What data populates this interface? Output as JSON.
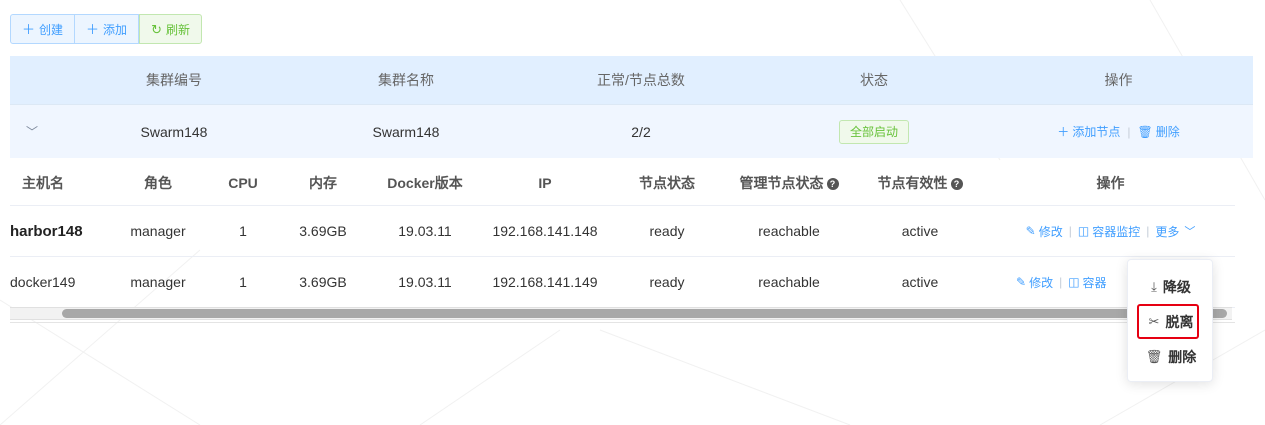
{
  "toolbar": {
    "create_label": "创建",
    "add_label": "添加",
    "refresh_label": "刷新"
  },
  "cluster_table": {
    "headers": [
      "集群编号",
      "集群名称",
      "正常/节点总数",
      "状态",
      "操作"
    ],
    "row": {
      "id": "Swarm148",
      "name": "Swarm148",
      "count": "2/2",
      "status": "全部启动",
      "add_node_label": "添加节点",
      "delete_label": "删除"
    }
  },
  "node_table": {
    "headers": {
      "host": "主机名",
      "role": "角色",
      "cpu": "CPU",
      "memory": "内存",
      "docker": "Docker版本",
      "ip": "IP",
      "node_state": "节点状态",
      "manager_state": "管理节点状态",
      "validity": "节点有效性",
      "ops": "操作"
    },
    "rows": [
      {
        "host": "harbor148",
        "role": "manager",
        "cpu": "1",
        "memory": "3.69GB",
        "docker": "19.03.11",
        "ip": "192.168.141.148",
        "node_state": "ready",
        "manager_state": "reachable",
        "validity": "active",
        "edit_label": "修改",
        "monitor_label": "容器监控",
        "more_label": "更多"
      },
      {
        "host": "docker149",
        "role": "manager",
        "cpu": "1",
        "memory": "3.69GB",
        "docker": "19.03.11",
        "ip": "192.168.141.149",
        "node_state": "ready",
        "manager_state": "reachable",
        "validity": "active",
        "edit_label": "修改",
        "monitor_label": "容器"
      }
    ]
  },
  "more_menu": {
    "items": [
      {
        "label": "降级",
        "icon": "download-icon"
      },
      {
        "label": "脱离",
        "icon": "scissors-icon"
      },
      {
        "label": "删除",
        "icon": "trash-icon"
      }
    ]
  },
  "colors": {
    "primary": "#409eff",
    "success": "#67c23a",
    "header_bg": "#e1efff",
    "highlight": "#e60012"
  }
}
